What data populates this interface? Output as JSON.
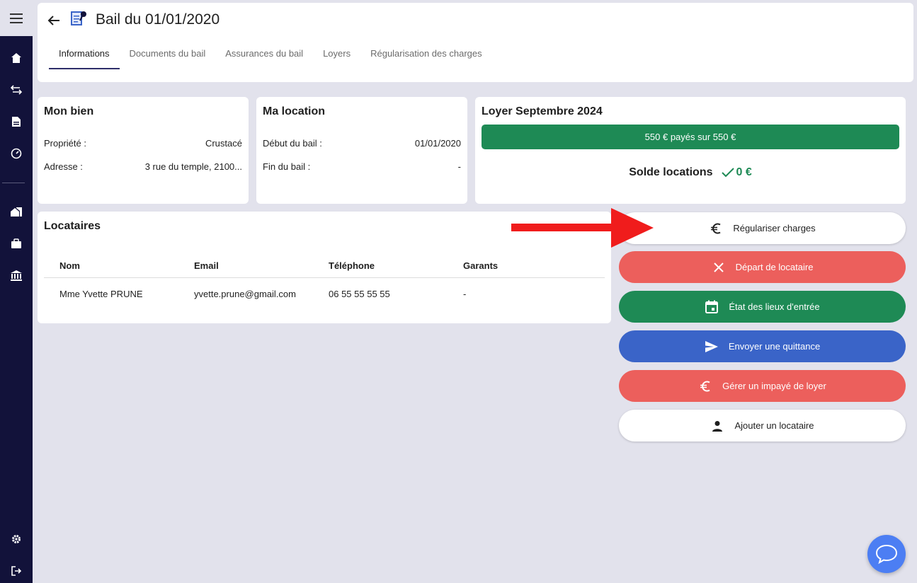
{
  "header": {
    "title": "Bail du 01/01/2020",
    "tabs": [
      {
        "label": "Informations"
      },
      {
        "label": "Documents du bail"
      },
      {
        "label": "Assurances du bail"
      },
      {
        "label": "Loyers"
      },
      {
        "label": "Régularisation des charges"
      }
    ],
    "active_tab": "Informations"
  },
  "sidebar": {
    "icons": [
      "menu-icon",
      "home-icon",
      "transfer-icon",
      "document-icon",
      "dashboard-icon",
      "properties-icon",
      "briefcase-icon",
      "bank-icon",
      "settings-icon",
      "logout-icon"
    ]
  },
  "mon_bien": {
    "title": "Mon bien",
    "propriete_label": "Propriété :",
    "propriete_value": "Crustacé",
    "adresse_label": "Adresse :",
    "adresse_value": "3 rue du temple, 2100..."
  },
  "ma_location": {
    "title": "Ma location",
    "debut_label": "Début du bail :",
    "debut_value": "01/01/2020",
    "fin_label": "Fin du bail :",
    "fin_value": "-"
  },
  "loyer": {
    "title": "Loyer Septembre 2024",
    "paid_text": "550 € payés sur 550 €",
    "paid_fraction": 1.0,
    "solde_label": "Solde locations",
    "solde_value": "0 €"
  },
  "locataires": {
    "title": "Locataires",
    "columns": [
      "Nom",
      "Email",
      "Téléphone",
      "Garants"
    ],
    "rows": [
      {
        "nom": "Mme Yvette PRUNE",
        "email": "yvette.prune@gmail.com",
        "telephone": "06 55 55 55 55",
        "garants": "-"
      }
    ]
  },
  "actions": [
    {
      "label": "Régulariser charges",
      "icon": "euro-icon",
      "bg": "#ffffff",
      "fg": "#1f1f1f"
    },
    {
      "label": "Départ de locataire",
      "icon": "close-icon",
      "bg": "#ec5f5c",
      "fg": "#ffffff"
    },
    {
      "label": "État des lieux d'entrée",
      "icon": "calendar-icon",
      "bg": "#1e8a55",
      "fg": "#ffffff"
    },
    {
      "label": "Envoyer une quittance",
      "icon": "send-icon",
      "bg": "#3a64c8",
      "fg": "#ffffff"
    },
    {
      "label": "Gérer un impayé de loyer",
      "icon": "euro-icon",
      "bg": "#ec5f5c",
      "fg": "#ffffff"
    },
    {
      "label": "Ajouter un locataire",
      "icon": "person-icon",
      "bg": "#ffffff",
      "fg": "#1f1f1f"
    }
  ],
  "colors": {
    "sidebar": "#12123a",
    "green": "#1e8a55",
    "red": "#ec5f5c",
    "blue": "#3a64c8",
    "chat": "#4c7ef3",
    "arrow": "#f01c1c"
  }
}
